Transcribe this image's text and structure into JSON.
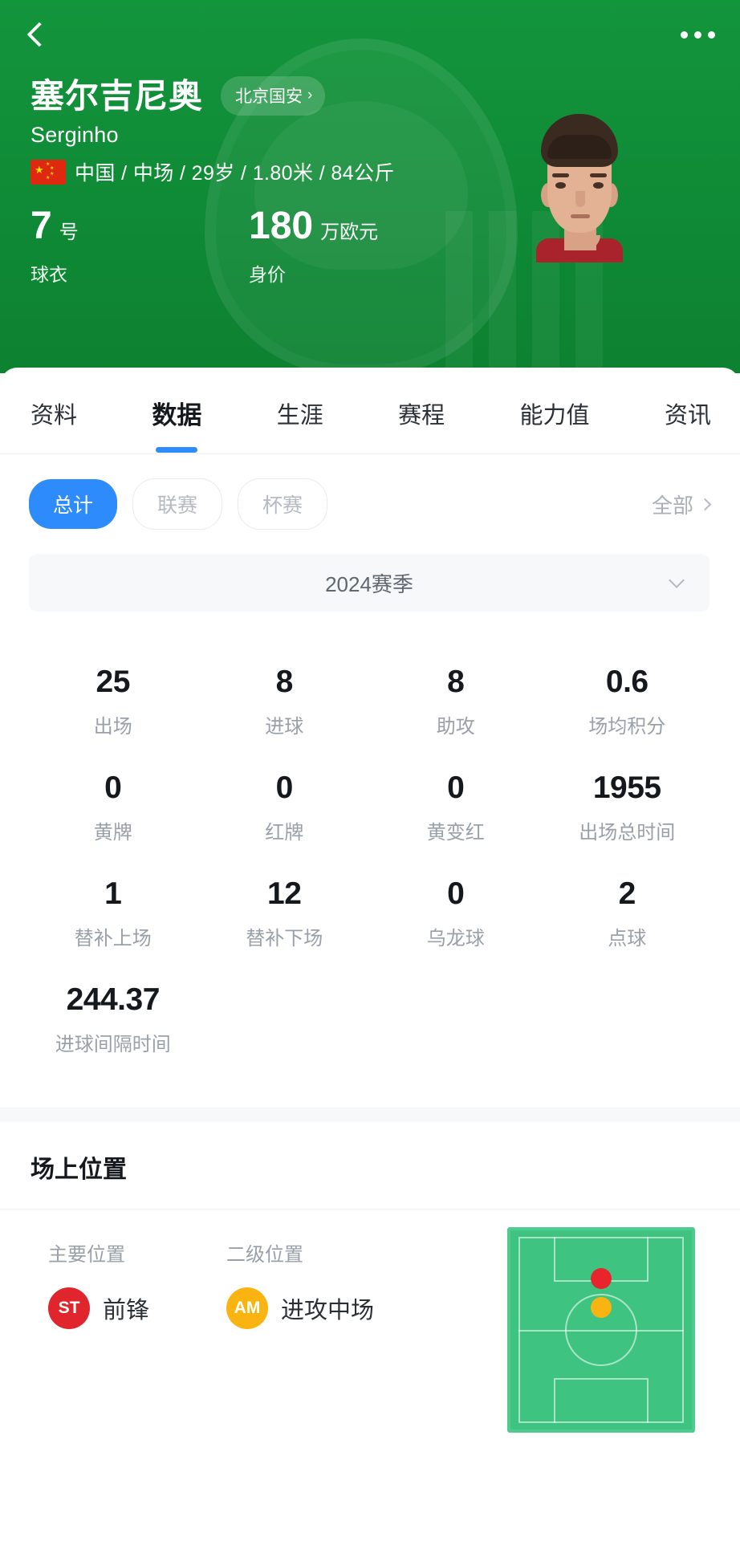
{
  "header": {
    "back_icon": "back-chevron-icon",
    "more_icon": "more-options-icon",
    "player_name_cn": "塞尔吉尼奥",
    "player_name_en": "Serginho",
    "team_chip": "北京国安",
    "team_chip_chevron": "›",
    "nationality_flag": "china-flag-icon",
    "meta_line": "中国 / 中场 / 29岁 / 1.80米 / 84公斤",
    "jersey": {
      "value": "7",
      "unit": "号",
      "label": "球衣"
    },
    "market_value": {
      "value": "180",
      "unit": "万欧元",
      "label": "身价"
    },
    "photo_alt": "player-photo"
  },
  "tabs": [
    {
      "label": "资料",
      "active": false
    },
    {
      "label": "数据",
      "active": true
    },
    {
      "label": "生涯",
      "active": false
    },
    {
      "label": "赛程",
      "active": false
    },
    {
      "label": "能力值",
      "active": false
    },
    {
      "label": "资讯",
      "active": false
    }
  ],
  "filters": {
    "pills": [
      {
        "label": "总计",
        "selected": true
      },
      {
        "label": "联赛",
        "selected": false
      },
      {
        "label": "杯赛",
        "selected": false
      }
    ],
    "all_label": "全部"
  },
  "season": {
    "label": "2024赛季",
    "caret_icon": "chevron-down-icon"
  },
  "stats": [
    {
      "value": "25",
      "label": "出场"
    },
    {
      "value": "8",
      "label": "进球"
    },
    {
      "value": "8",
      "label": "助攻"
    },
    {
      "value": "0.6",
      "label": "场均积分"
    },
    {
      "value": "0",
      "label": "黄牌"
    },
    {
      "value": "0",
      "label": "红牌"
    },
    {
      "value": "0",
      "label": "黄变红"
    },
    {
      "value": "1955",
      "label": "出场总时间"
    },
    {
      "value": "1",
      "label": "替补上场"
    },
    {
      "value": "12",
      "label": "替补下场"
    },
    {
      "value": "0",
      "label": "乌龙球"
    },
    {
      "value": "2",
      "label": "点球"
    },
    {
      "value": "244.37",
      "label": "进球间隔时间"
    }
  ],
  "position_section": {
    "title": "场上位置",
    "primary": {
      "head": "主要位置",
      "code": "ST",
      "name": "前锋",
      "color": "#e0262c"
    },
    "secondary": {
      "head": "二级位置",
      "code": "AM",
      "name": "进攻中场",
      "color": "#f9b412"
    },
    "pitch_alt": "pitch-diagram"
  },
  "colors": {
    "brand_green": "#12913a",
    "accent_blue": "#2e8bfb",
    "pitch_green": "#3fc380",
    "primary_red": "#e0262c",
    "secondary_yellow": "#f9b412"
  }
}
